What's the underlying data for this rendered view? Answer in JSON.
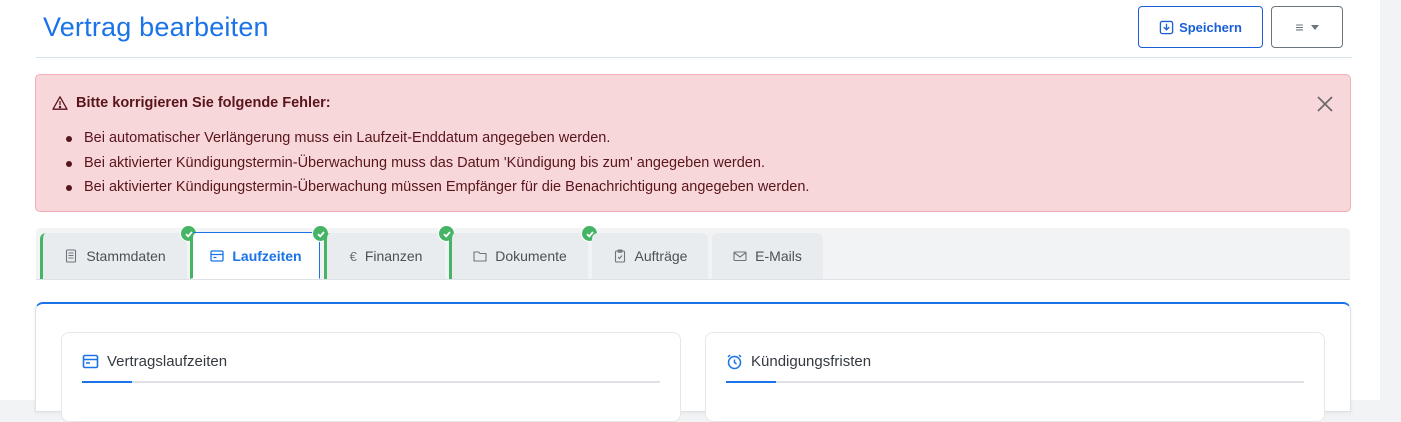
{
  "header": {
    "title": "Vertrag bearbeiten",
    "save_label": "Speichern",
    "menu_glyph": "≡"
  },
  "alert": {
    "heading": "Bitte korrigieren Sie folgende Fehler:",
    "errors": [
      "Bei automatischer Verlängerung muss ein Laufzeit-Enddatum angegeben werden.",
      "Bei aktivierter Kündigungstermin-Überwachung muss das Datum 'Kündigung bis zum' angegeben werden.",
      "Bei aktivierter Kündigungstermin-Überwachung müssen Empfänger für die Benachrichtigung angegeben werden."
    ]
  },
  "tabs": [
    {
      "label": "Stammdaten",
      "icon": "document-icon",
      "valid": true,
      "active": false
    },
    {
      "label": "Laufzeiten",
      "icon": "calendar-icon",
      "valid": true,
      "active": true
    },
    {
      "label": "Finanzen",
      "icon": "euro-icon",
      "valid": true,
      "active": false
    },
    {
      "label": "Dokumente",
      "icon": "folder-icon",
      "valid": true,
      "active": false
    },
    {
      "label": "Aufträge",
      "icon": "clipboard-icon",
      "valid": false,
      "active": false
    },
    {
      "label": "E-Mails",
      "icon": "envelope-icon",
      "valid": false,
      "active": false
    }
  ],
  "cards": [
    {
      "title": "Vertragslaufzeiten",
      "icon": "calendar-icon"
    },
    {
      "title": "Kündigungsfristen",
      "icon": "alarm-clock-icon"
    }
  ],
  "colors": {
    "accent": "#1a73e8",
    "valid": "#45b464",
    "alert_bg": "#f8d7da",
    "alert_text": "#58151c"
  }
}
